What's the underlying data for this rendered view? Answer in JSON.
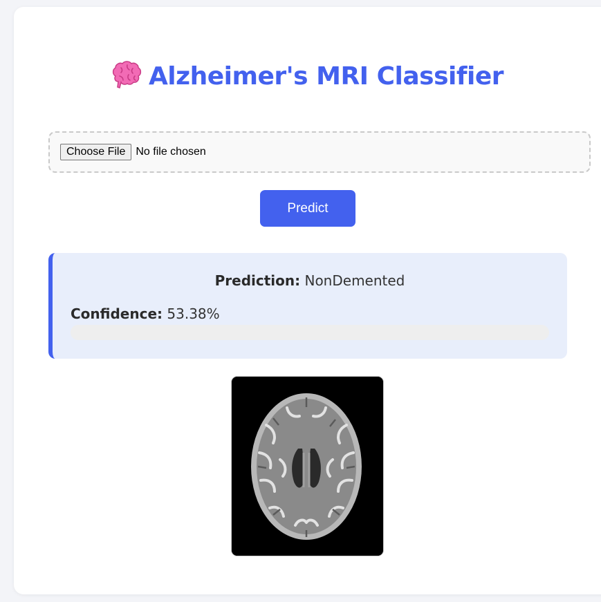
{
  "header": {
    "icon": "brain-icon",
    "title": "Alzheimer's MRI Classifier"
  },
  "upload": {
    "choose_label": "Choose File",
    "status_text": "No file chosen"
  },
  "predict": {
    "label": "Predict"
  },
  "result": {
    "prediction_label": "Prediction:",
    "prediction_value": "NonDemented",
    "confidence_label": "Confidence:",
    "confidence_value": "53.38%",
    "confidence_fraction": 0.5338
  },
  "colors": {
    "accent": "#4361ee",
    "result_bg": "#e8eefb"
  }
}
